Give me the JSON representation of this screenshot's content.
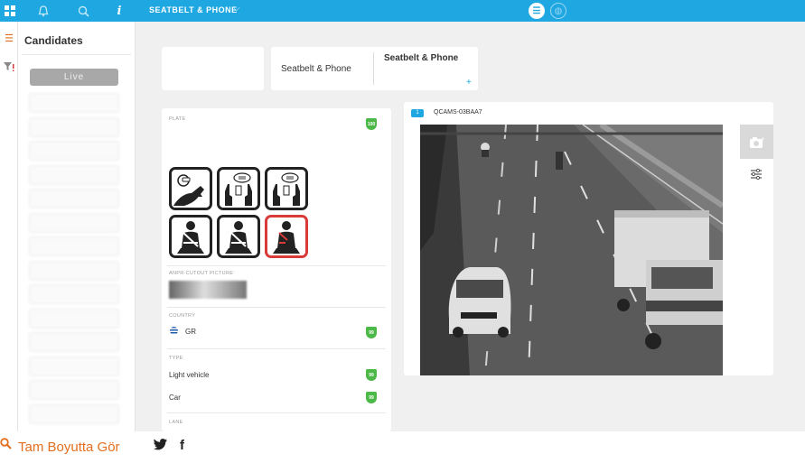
{
  "topbar": {
    "title": "SEATBELT & PHONE",
    "icons": [
      "grid-icon",
      "bell-icon",
      "search-icon",
      "info-icon",
      "chevron-down-icon",
      "list-view-icon",
      "globe-view-icon"
    ]
  },
  "rail": {
    "icons": [
      "list-icon",
      "filter-icon"
    ]
  },
  "candidates": {
    "title": "Candidates",
    "live_label": "Live",
    "items": [
      "",
      "",
      "",
      "",
      "",
      "",
      "",
      "",
      "",
      "",
      "",
      "",
      "",
      ""
    ]
  },
  "plate_card": {
    "value": ""
  },
  "event_card": {
    "left_label": "Seatbelt & Phone",
    "right_label": "Seatbelt & Phone",
    "add_symbol": "+"
  },
  "details": {
    "plate": {
      "label": "PLATE",
      "value": "",
      "score": "100"
    },
    "pictograms": [
      "phone-talking",
      "phone-texting",
      "phone-texting",
      "seatbelt-fastened",
      "seatbelt-fastened",
      "seatbelt-unfastened"
    ],
    "cutout": {
      "label": "ANPR-CUTOUT PICTURE"
    },
    "country": {
      "label": "COUNTRY",
      "value": "GR",
      "score": "99"
    },
    "type": {
      "label": "TYPE",
      "value1": "Light vehicle",
      "score1": "99",
      "value2": "Car",
      "score2": "99"
    },
    "lane": {
      "label": "LANE"
    }
  },
  "camera": {
    "title": "QCAMS-03BAA7",
    "badge": "1"
  },
  "footer": {
    "zoom_link": "Tam Boyutta Gör"
  },
  "colors": {
    "accent": "#1ea7e1",
    "score": "#4cb848",
    "alert": "#d93a3a",
    "link": "#e26f1f"
  }
}
